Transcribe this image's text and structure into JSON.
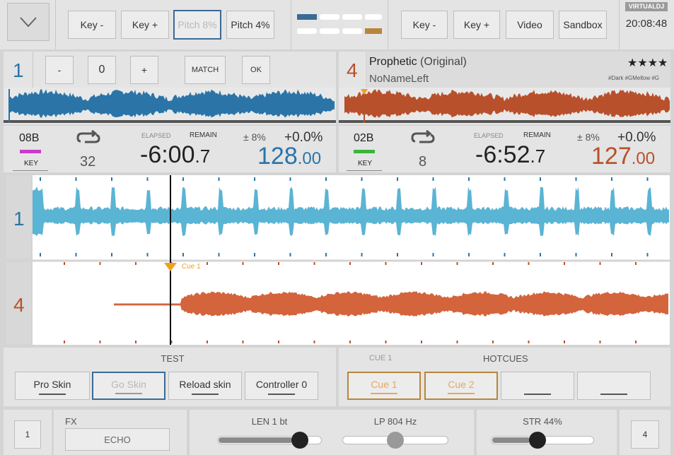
{
  "top_bar": {
    "menu_icon": "chevron-down-icon",
    "left_buttons": [
      "Key -",
      "Key +",
      "Pitch 8%",
      "Pitch 4%"
    ],
    "right_buttons": [
      "Key -",
      "Key +",
      "Video",
      "Sandbox"
    ],
    "logo": "VIRTUALDJ",
    "clock": "20:08:48"
  },
  "deck1": {
    "number": "1",
    "pitch_buttons": [
      "-",
      "0",
      "+"
    ],
    "match_label": "MATCH",
    "ok_label": "OK",
    "key": "08B",
    "key_label": "KEY",
    "key_color": "#c83cc8",
    "loop_value": "32",
    "elapsed_label": "ELAPSED",
    "remain_label": "REMAIN",
    "time_main": "-6:00",
    "time_dec": ".7",
    "pitch_range": "± 8%",
    "pitch_value": "+0.0%",
    "bpm_main": "128",
    "bpm_dec": ".00"
  },
  "deck4": {
    "number": "4",
    "title": "Prophetic",
    "title_suffix": " (Original)",
    "artist": "NoNameLeft",
    "stars": "★★★★",
    "tags": "#Dark #GMellow #G",
    "key": "02B",
    "key_label": "KEY",
    "key_color": "#3cb43c",
    "loop_value": "8",
    "elapsed_label": "ELAPSED",
    "remain_label": "REMAIN",
    "time_main": "-6:52",
    "time_dec": ".7",
    "pitch_range": "± 8%",
    "pitch_value": "+0.0%",
    "bpm_main": "127",
    "bpm_dec": ".00"
  },
  "waveform": {
    "deck1_label": "1",
    "deck4_label": "4",
    "cue_label": "Cue 1"
  },
  "bottom_left": {
    "title": "TEST",
    "buttons": [
      "Pro Skin",
      "Go Skin",
      "Reload skin",
      "Controller 0"
    ]
  },
  "bottom_right": {
    "cue_label": "CUE 1",
    "title": "HOTCUES",
    "buttons": [
      "Cue 1",
      "Cue 2",
      "",
      ""
    ]
  },
  "footer": {
    "deck_left": "1",
    "deck_right": "4",
    "fx_label": "FX",
    "fx_value": "ECHO",
    "len_label": "LEN 1 bt",
    "len_value": 0.85,
    "lp_label": "LP 804 Hz",
    "lp_value": 0.5,
    "str_label": "STR 44%",
    "str_value": 0.44
  },
  "colors": {
    "deck1": "#2a74a8",
    "deck4": "#b8502c",
    "wave1": "#5ab4d4",
    "wave4": "#d4643c",
    "cue": "#f0a020"
  }
}
